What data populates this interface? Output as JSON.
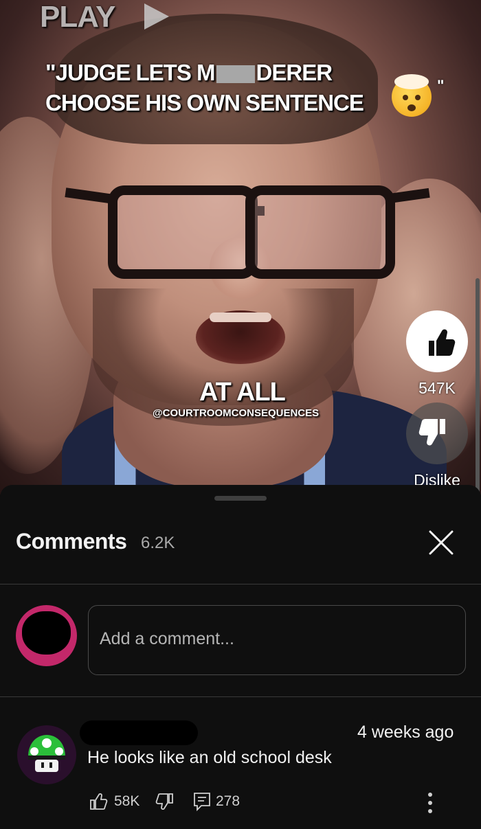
{
  "video": {
    "play_label": "PLAY",
    "headline_line1_a": "\"JUDGE LETS M",
    "headline_line1_b": "DERER",
    "headline_line2": "CHOOSE HIS OWN SENTENCE",
    "quote_end": "\"",
    "caption": "AT ALL",
    "watermark": "@COURTROOMCONSEQUENCES"
  },
  "actions": {
    "like_count": "547K",
    "dislike_label": "Dislike"
  },
  "comments": {
    "title": "Comments",
    "count": "6.2K",
    "input_placeholder": "Add a comment...",
    "items": [
      {
        "time": "4 weeks ago",
        "text": "He looks like an old school desk",
        "likes": "58K",
        "replies": "278"
      }
    ]
  },
  "colors": {
    "self_avatar_ring": "#c3286a",
    "background": "#0f0f0f",
    "text_primary": "#f1f1f1",
    "text_secondary": "#aaaaaa"
  },
  "icons": [
    "play-icon",
    "mind-blown-emoji-icon",
    "thumbs-up-icon",
    "thumbs-down-icon",
    "close-icon",
    "mushroom-avatar-icon",
    "reply-icon",
    "more-vert-icon"
  ]
}
